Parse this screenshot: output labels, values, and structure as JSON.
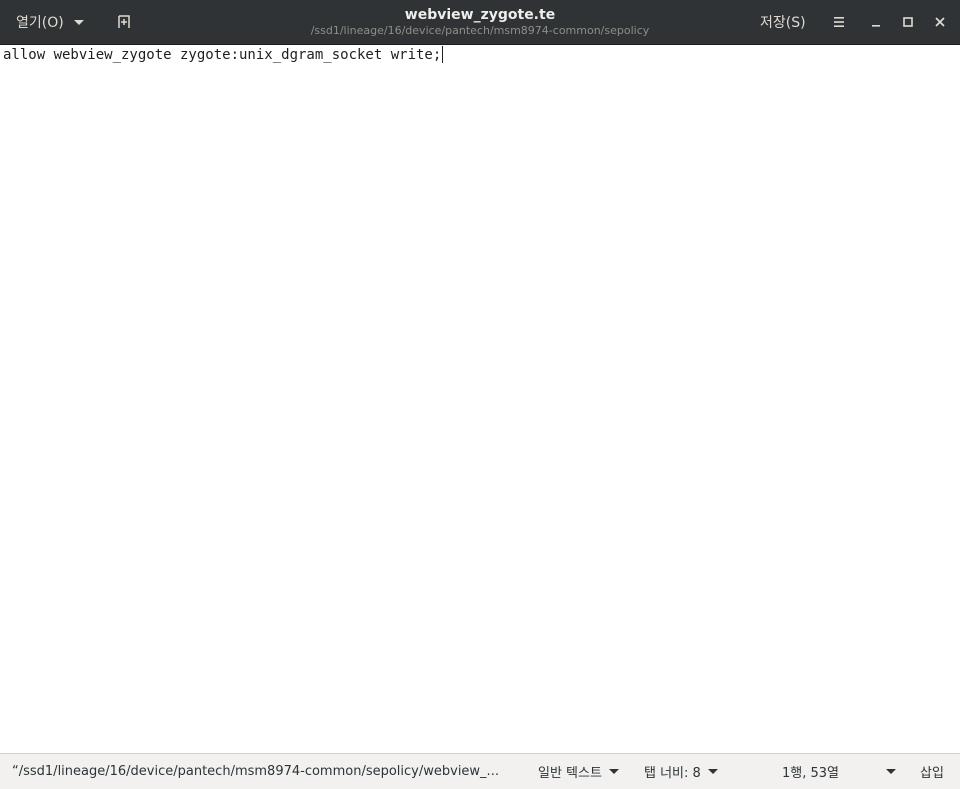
{
  "header": {
    "open_label": "열기(O)",
    "title": "webview_zygote.te",
    "subtitle": "/ssd1/lineage/16/device/pantech/msm8974-common/sepolicy",
    "save_label": "저장(S)"
  },
  "editor": {
    "lines": [
      "allow webview_zygote zygote:unix_dgram_socket write;"
    ]
  },
  "statusbar": {
    "path": "“/ssd1/lineage/16/device/pantech/msm8974-common/sepolicy/webview_...",
    "language": "일반 텍스트",
    "tab_width": "탭 너비: 8",
    "position": "1행, 53열",
    "insert_mode": "삽입"
  },
  "colors": {
    "headerbar": "#2f3335",
    "statusbar": "#f2f1f0",
    "editor_bg": "#ffffff"
  }
}
